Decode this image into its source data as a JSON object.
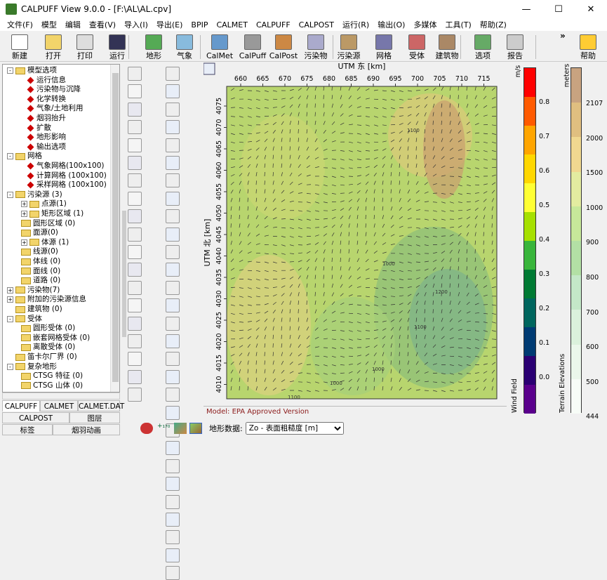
{
  "window": {
    "title": "CALPUFF View 9.0.0 - [F:\\AL\\AL.cpv]"
  },
  "menu": [
    "文件(F)",
    "模型",
    "编辑",
    "查看(V)",
    "导入(I)",
    "导出(E)",
    "BPIP",
    "CALMET",
    "CALPUFF",
    "CALPOST",
    "运行(R)",
    "输出(O)",
    "多媒体",
    "工具(T)",
    "帮助(Z)"
  ],
  "toolbar": [
    {
      "label": "新建",
      "icon": "new-file-icon"
    },
    {
      "label": "打开",
      "icon": "folder-open-icon"
    },
    {
      "label": "打印",
      "icon": "printer-icon"
    },
    {
      "label": "运行",
      "icon": "run-icon"
    },
    {
      "label": "地形",
      "icon": "terrain-icon"
    },
    {
      "label": "气象",
      "icon": "weather-icon"
    },
    {
      "label": "CalMet",
      "icon": "calmet-icon"
    },
    {
      "label": "CalPuff",
      "icon": "calpuff-icon"
    },
    {
      "label": "CalPost",
      "icon": "calpost-icon"
    },
    {
      "label": "污染物",
      "icon": "pollutant-icon"
    },
    {
      "label": "污染源",
      "icon": "source-icon"
    },
    {
      "label": "网格",
      "icon": "grid-icon"
    },
    {
      "label": "受体",
      "icon": "receptor-icon"
    },
    {
      "label": "建筑物",
      "icon": "building-icon"
    },
    {
      "label": "选项",
      "icon": "options-icon"
    },
    {
      "label": "报告",
      "icon": "report-icon"
    },
    {
      "label": "帮助",
      "icon": "help-icon"
    }
  ],
  "toolbar_overflow": "»",
  "tree": [
    {
      "text": "模型选项",
      "level": 0,
      "kind": "folder",
      "exp": "-"
    },
    {
      "text": "运行信息",
      "level": 1,
      "kind": "item"
    },
    {
      "text": "污染物与沉降",
      "level": 1,
      "kind": "item"
    },
    {
      "text": "化学转换",
      "level": 1,
      "kind": "item"
    },
    {
      "text": "气象/土地利用",
      "level": 1,
      "kind": "item"
    },
    {
      "text": "烟羽抬升",
      "level": 1,
      "kind": "item"
    },
    {
      "text": "扩散",
      "level": 1,
      "kind": "item"
    },
    {
      "text": "地形影响",
      "level": 1,
      "kind": "item"
    },
    {
      "text": "输出选项",
      "level": 1,
      "kind": "item"
    },
    {
      "text": "网格",
      "level": 0,
      "kind": "folder",
      "exp": "-"
    },
    {
      "text": "气象网格(100x100)",
      "level": 1,
      "kind": "item"
    },
    {
      "text": "计算网格 (100x100)",
      "level": 1,
      "kind": "item"
    },
    {
      "text": "采样网格 (100x100)",
      "level": 1,
      "kind": "item"
    },
    {
      "text": "污染源 (3)",
      "level": 0,
      "kind": "folder",
      "exp": "-"
    },
    {
      "text": "点源(1)",
      "level": 1,
      "kind": "folder",
      "exp": "+"
    },
    {
      "text": "矩形区域 (1)",
      "level": 1,
      "kind": "folder",
      "exp": "+"
    },
    {
      "text": "圆形区域 (0)",
      "level": 1,
      "kind": "folder"
    },
    {
      "text": "面源(0)",
      "level": 1,
      "kind": "folder"
    },
    {
      "text": "体源 (1)",
      "level": 1,
      "kind": "folder",
      "exp": "+"
    },
    {
      "text": "线源(0)",
      "level": 1,
      "kind": "folder"
    },
    {
      "text": "体线 (0)",
      "level": 1,
      "kind": "folder"
    },
    {
      "text": "面线 (0)",
      "level": 1,
      "kind": "folder"
    },
    {
      "text": "道路 (0)",
      "level": 1,
      "kind": "folder"
    },
    {
      "text": "污染物(7)",
      "level": 0,
      "kind": "folder",
      "exp": "+"
    },
    {
      "text": "附加的污染源信息",
      "level": 0,
      "kind": "folder",
      "exp": "+"
    },
    {
      "text": "建筑物 (0)",
      "level": 0,
      "kind": "folder"
    },
    {
      "text": "受体",
      "level": 0,
      "kind": "folder",
      "exp": "-"
    },
    {
      "text": "圆形受体 (0)",
      "level": 1,
      "kind": "folder"
    },
    {
      "text": "嵌套网格受体 (0)",
      "level": 1,
      "kind": "folder"
    },
    {
      "text": "离散受体 (0)",
      "level": 1,
      "kind": "folder"
    },
    {
      "text": "笛卡尔厂界 (0)",
      "level": 0,
      "kind": "folder"
    },
    {
      "text": "复杂地形",
      "level": 0,
      "kind": "folder",
      "exp": "-"
    },
    {
      "text": "CTSG 特征 (0)",
      "level": 1,
      "kind": "folder"
    },
    {
      "text": "CTSG 山体 (0)",
      "level": 1,
      "kind": "folder"
    }
  ],
  "tabs": [
    "CALPUFF",
    "CALMET",
    "CALMET.DAT",
    "CALPOST",
    "图层",
    "标签",
    "烟羽动画"
  ],
  "map": {
    "x_axis_label": "UTM 东 [km]",
    "y_axis_label": "UTM 北 [km]",
    "x_ticks": [
      660,
      665,
      670,
      675,
      680,
      685,
      690,
      695,
      700,
      705,
      710,
      715
    ],
    "y_ticks": [
      4075,
      4070,
      4065,
      4060,
      4055,
      4050,
      4045,
      4040,
      4035,
      4030,
      4025,
      4020,
      4015,
      4010
    ],
    "contour_labels": [
      "1000",
      "1000",
      "1100",
      "1200",
      "1000",
      "1100",
      "1100"
    ],
    "status": "Model: EPA Approved Version"
  },
  "bottom": {
    "terrain_label": "地形数据:",
    "terrain_value": "Zo - 表面粗糙度 [m]"
  },
  "wind_legend": {
    "title": "Wind Field",
    "unit": "m/s",
    "ticks": [
      "0.8",
      "0.7",
      "0.6",
      "0.5",
      "0.4",
      "0.3",
      "0.2",
      "0.1",
      "0.0"
    ],
    "colors": [
      "#ff0000",
      "#ff5a00",
      "#ffa500",
      "#ffd700",
      "#ffff33",
      "#a6e000",
      "#39b53b",
      "#007a33",
      "#00665e",
      "#003b73",
      "#2b0073",
      "#5a008c"
    ]
  },
  "terrain_legend": {
    "title": "Terrain Elevations",
    "unit": "meters",
    "ticks": [
      "2107",
      "2000",
      "1500",
      "1000",
      "900",
      "800",
      "700",
      "600",
      "500",
      "444"
    ],
    "colors": [
      "#c8a380",
      "#e0bf80",
      "#f0d890",
      "#e3eca0",
      "#c7e89a",
      "#b3e0a5",
      "#c4e8c8",
      "#dbf1dc",
      "#ebf7eb",
      "#f7fcf7"
    ]
  }
}
